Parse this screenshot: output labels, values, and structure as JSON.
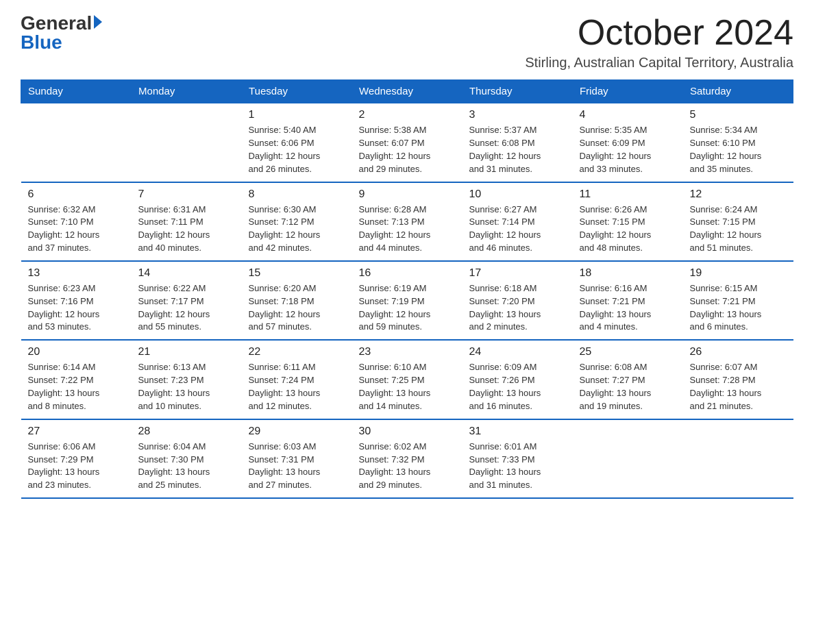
{
  "logo": {
    "general": "General",
    "blue": "Blue"
  },
  "header": {
    "month_title": "October 2024",
    "subtitle": "Stirling, Australian Capital Territory, Australia"
  },
  "weekdays": [
    "Sunday",
    "Monday",
    "Tuesday",
    "Wednesday",
    "Thursday",
    "Friday",
    "Saturday"
  ],
  "weeks": [
    [
      {
        "day": "",
        "info": ""
      },
      {
        "day": "",
        "info": ""
      },
      {
        "day": "1",
        "info": "Sunrise: 5:40 AM\nSunset: 6:06 PM\nDaylight: 12 hours\nand 26 minutes."
      },
      {
        "day": "2",
        "info": "Sunrise: 5:38 AM\nSunset: 6:07 PM\nDaylight: 12 hours\nand 29 minutes."
      },
      {
        "day": "3",
        "info": "Sunrise: 5:37 AM\nSunset: 6:08 PM\nDaylight: 12 hours\nand 31 minutes."
      },
      {
        "day": "4",
        "info": "Sunrise: 5:35 AM\nSunset: 6:09 PM\nDaylight: 12 hours\nand 33 minutes."
      },
      {
        "day": "5",
        "info": "Sunrise: 5:34 AM\nSunset: 6:10 PM\nDaylight: 12 hours\nand 35 minutes."
      }
    ],
    [
      {
        "day": "6",
        "info": "Sunrise: 6:32 AM\nSunset: 7:10 PM\nDaylight: 12 hours\nand 37 minutes."
      },
      {
        "day": "7",
        "info": "Sunrise: 6:31 AM\nSunset: 7:11 PM\nDaylight: 12 hours\nand 40 minutes."
      },
      {
        "day": "8",
        "info": "Sunrise: 6:30 AM\nSunset: 7:12 PM\nDaylight: 12 hours\nand 42 minutes."
      },
      {
        "day": "9",
        "info": "Sunrise: 6:28 AM\nSunset: 7:13 PM\nDaylight: 12 hours\nand 44 minutes."
      },
      {
        "day": "10",
        "info": "Sunrise: 6:27 AM\nSunset: 7:14 PM\nDaylight: 12 hours\nand 46 minutes."
      },
      {
        "day": "11",
        "info": "Sunrise: 6:26 AM\nSunset: 7:15 PM\nDaylight: 12 hours\nand 48 minutes."
      },
      {
        "day": "12",
        "info": "Sunrise: 6:24 AM\nSunset: 7:15 PM\nDaylight: 12 hours\nand 51 minutes."
      }
    ],
    [
      {
        "day": "13",
        "info": "Sunrise: 6:23 AM\nSunset: 7:16 PM\nDaylight: 12 hours\nand 53 minutes."
      },
      {
        "day": "14",
        "info": "Sunrise: 6:22 AM\nSunset: 7:17 PM\nDaylight: 12 hours\nand 55 minutes."
      },
      {
        "day": "15",
        "info": "Sunrise: 6:20 AM\nSunset: 7:18 PM\nDaylight: 12 hours\nand 57 minutes."
      },
      {
        "day": "16",
        "info": "Sunrise: 6:19 AM\nSunset: 7:19 PM\nDaylight: 12 hours\nand 59 minutes."
      },
      {
        "day": "17",
        "info": "Sunrise: 6:18 AM\nSunset: 7:20 PM\nDaylight: 13 hours\nand 2 minutes."
      },
      {
        "day": "18",
        "info": "Sunrise: 6:16 AM\nSunset: 7:21 PM\nDaylight: 13 hours\nand 4 minutes."
      },
      {
        "day": "19",
        "info": "Sunrise: 6:15 AM\nSunset: 7:21 PM\nDaylight: 13 hours\nand 6 minutes."
      }
    ],
    [
      {
        "day": "20",
        "info": "Sunrise: 6:14 AM\nSunset: 7:22 PM\nDaylight: 13 hours\nand 8 minutes."
      },
      {
        "day": "21",
        "info": "Sunrise: 6:13 AM\nSunset: 7:23 PM\nDaylight: 13 hours\nand 10 minutes."
      },
      {
        "day": "22",
        "info": "Sunrise: 6:11 AM\nSunset: 7:24 PM\nDaylight: 13 hours\nand 12 minutes."
      },
      {
        "day": "23",
        "info": "Sunrise: 6:10 AM\nSunset: 7:25 PM\nDaylight: 13 hours\nand 14 minutes."
      },
      {
        "day": "24",
        "info": "Sunrise: 6:09 AM\nSunset: 7:26 PM\nDaylight: 13 hours\nand 16 minutes."
      },
      {
        "day": "25",
        "info": "Sunrise: 6:08 AM\nSunset: 7:27 PM\nDaylight: 13 hours\nand 19 minutes."
      },
      {
        "day": "26",
        "info": "Sunrise: 6:07 AM\nSunset: 7:28 PM\nDaylight: 13 hours\nand 21 minutes."
      }
    ],
    [
      {
        "day": "27",
        "info": "Sunrise: 6:06 AM\nSunset: 7:29 PM\nDaylight: 13 hours\nand 23 minutes."
      },
      {
        "day": "28",
        "info": "Sunrise: 6:04 AM\nSunset: 7:30 PM\nDaylight: 13 hours\nand 25 minutes."
      },
      {
        "day": "29",
        "info": "Sunrise: 6:03 AM\nSunset: 7:31 PM\nDaylight: 13 hours\nand 27 minutes."
      },
      {
        "day": "30",
        "info": "Sunrise: 6:02 AM\nSunset: 7:32 PM\nDaylight: 13 hours\nand 29 minutes."
      },
      {
        "day": "31",
        "info": "Sunrise: 6:01 AM\nSunset: 7:33 PM\nDaylight: 13 hours\nand 31 minutes."
      },
      {
        "day": "",
        "info": ""
      },
      {
        "day": "",
        "info": ""
      }
    ]
  ]
}
